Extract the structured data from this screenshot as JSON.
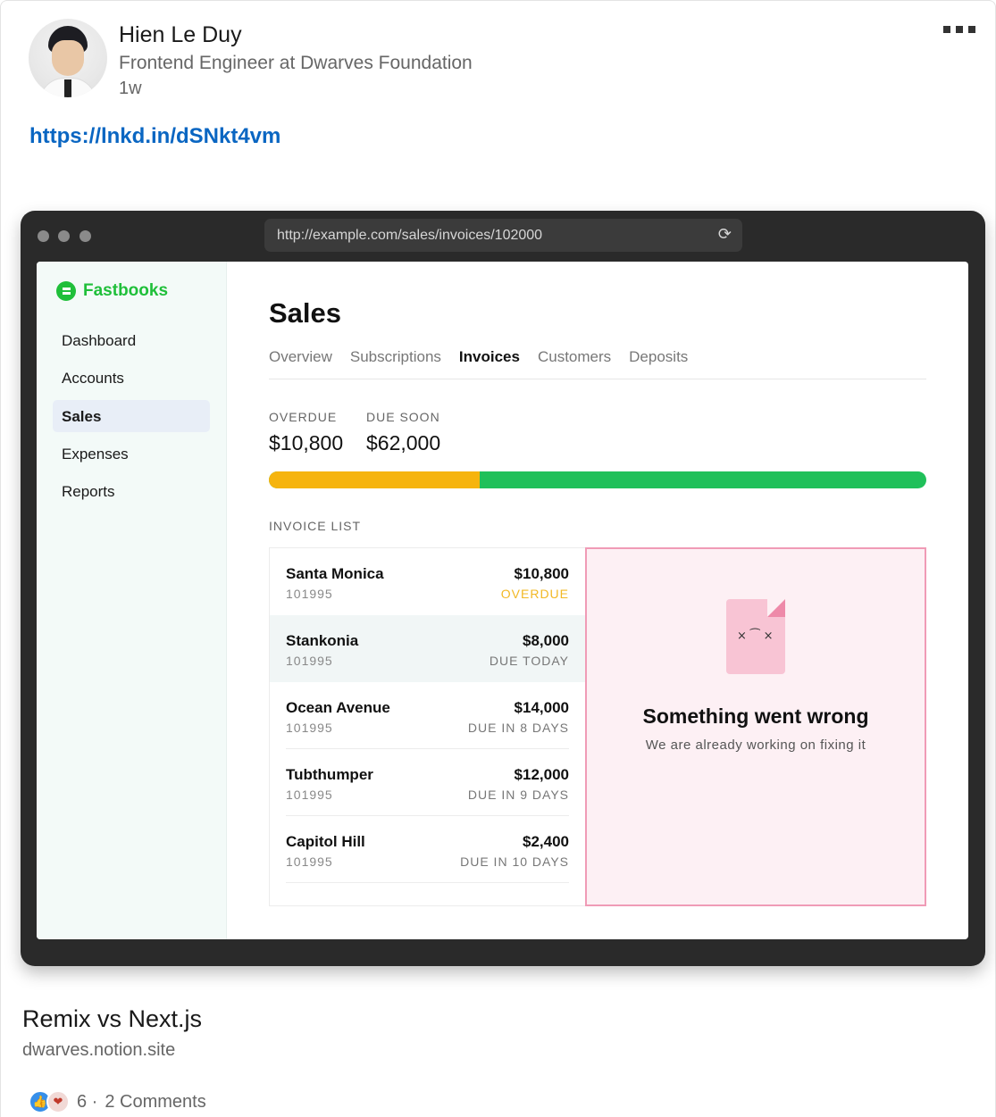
{
  "post": {
    "author_name": "Hien Le Duy",
    "author_title": "Frontend Engineer at Dwarves Foundation",
    "time": "1w",
    "link": "https://lnkd.in/dSNkt4vm"
  },
  "browser": {
    "url": "http://example.com/sales/invoices/102000",
    "reload_icon": "⟳"
  },
  "app": {
    "brand": "Fastbooks",
    "nav": [
      {
        "label": "Dashboard"
      },
      {
        "label": "Accounts"
      },
      {
        "label": "Sales",
        "active": true
      },
      {
        "label": "Expenses"
      },
      {
        "label": "Reports"
      }
    ],
    "page_title": "Sales",
    "tabs": [
      "Overview",
      "Subscriptions",
      "Invoices",
      "Customers",
      "Deposits"
    ],
    "active_tab": "Invoices",
    "stats": {
      "overdue_label": "OVERDUE",
      "overdue_value": "$10,800",
      "due_soon_label": "DUE SOON",
      "due_soon_value": "$62,000"
    },
    "overdue_fraction": 0.32,
    "list_heading": "INVOICE LIST",
    "invoices": [
      {
        "name": "Santa Monica",
        "id": "101995",
        "amount": "$10,800",
        "status": "OVERDUE"
      },
      {
        "name": "Stankonia",
        "id": "101995",
        "amount": "$8,000",
        "status": "DUE TODAY"
      },
      {
        "name": "Ocean Avenue",
        "id": "101995",
        "amount": "$14,000",
        "status": "DUE IN 8 DAYS"
      },
      {
        "name": "Tubthumper",
        "id": "101995",
        "amount": "$12,000",
        "status": "DUE IN 9 DAYS"
      },
      {
        "name": "Capitol Hill",
        "id": "101995",
        "amount": "$2,400",
        "status": "DUE IN 10 DAYS"
      }
    ],
    "error": {
      "face": "× ⁀ ×",
      "title": "Something went wrong",
      "subtitle": "We are already working on fixing it"
    }
  },
  "preview": {
    "title": "Remix vs Next.js",
    "domain": "dwarves.notion.site"
  },
  "social": {
    "reaction_count": "6 ·",
    "comments": "2 Comments"
  },
  "colors": {
    "link": "#0a66c2",
    "brand": "#1fbf3a",
    "overdue": "#f6b40e",
    "due": "#20c05a",
    "error_border": "#f09bb6"
  }
}
